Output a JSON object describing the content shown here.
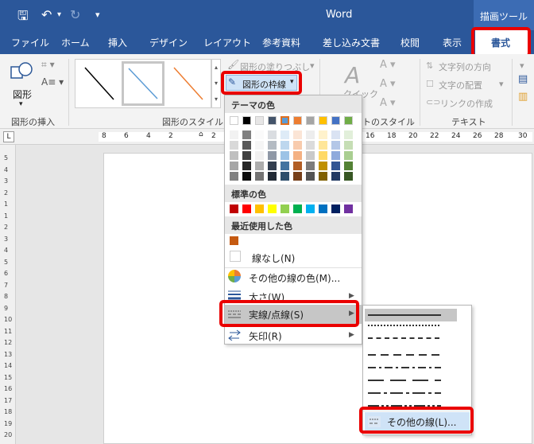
{
  "app": {
    "title": "Word",
    "context_tab": "描画ツール"
  },
  "tabs": [
    "ファイル",
    "ホーム",
    "挿入",
    "デザイン",
    "レイアウト",
    "参考資料",
    "差し込み文書",
    "校閲",
    "表示",
    "書式"
  ],
  "ribbon": {
    "shape_label": "図形",
    "fill_label": "図形の塗りつぶし",
    "outline_label": "図形の枠線",
    "text_direction": "文字列の方向",
    "text_align": "文字の配置",
    "link_create": "リンクの作成",
    "quick_label": "クイック",
    "groups": {
      "insert": "図形の挿入",
      "style": "図形のスタイル",
      "wordart": "トのスタイル",
      "text": "テキスト"
    }
  },
  "ruler": {
    "ticks": [
      "8",
      "6",
      "4",
      "2",
      "2",
      "16",
      "18",
      "20",
      "22",
      "24",
      "26",
      "28",
      "30"
    ],
    "vticks": [
      "5",
      "4",
      "3",
      "2",
      "1",
      "1",
      "2",
      "3",
      "4",
      "5",
      "6",
      "7",
      "8",
      "9",
      "10",
      "11",
      "12",
      "13",
      "14",
      "15",
      "16",
      "17",
      "18",
      "19",
      "20"
    ]
  },
  "menu": {
    "theme_header": "テーマの色",
    "standard_header": "標準の色",
    "recent_header": "最近使用した色",
    "no_line": "線なし(N)",
    "more_colors": "その他の線の色(M)...",
    "weight": "太さ(W)",
    "dashes": "実線/点線(S)",
    "arrows": "矢印(R)"
  },
  "submenu": {
    "more_lines": "その他の線(L)..."
  },
  "colors": {
    "theme_top": [
      "#ffffff",
      "#000000",
      "#e7e6e6",
      "#44546a",
      "#5b9bd5",
      "#ed7d31",
      "#a5a5a5",
      "#ffc000",
      "#4472c4",
      "#70ad47"
    ],
    "standard": [
      "#c00000",
      "#ff0000",
      "#ffc000",
      "#ffff00",
      "#92d050",
      "#00b050",
      "#00b0f0",
      "#0070c0",
      "#002060",
      "#7030a0"
    ],
    "recent": "#c55a11",
    "title_bar": "#2b579a",
    "highlight": "#ea0000"
  }
}
